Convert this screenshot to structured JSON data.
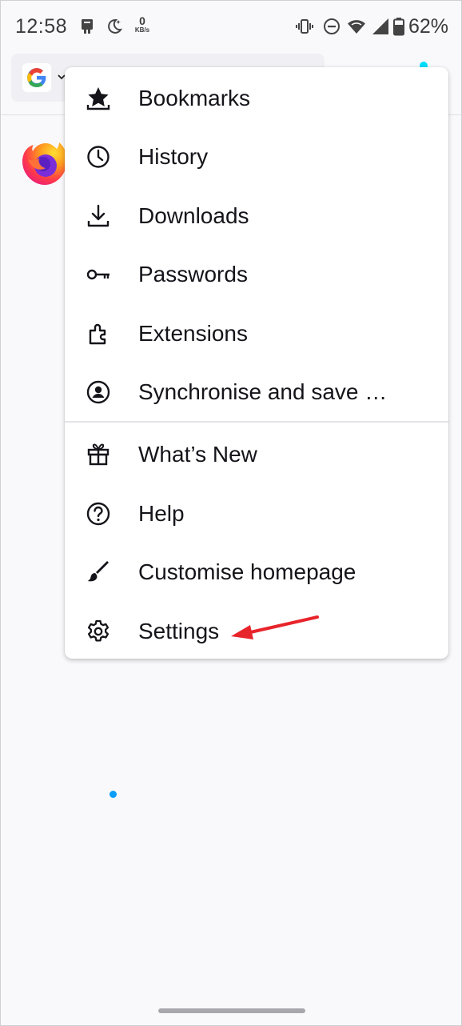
{
  "status_bar": {
    "time": "12:58",
    "net_speed_value": "0",
    "net_speed_unit": "KB/s",
    "battery": "62%"
  },
  "toolbar": {
    "search_engine_icon": "google-g-icon",
    "attention_dot_color": "#00ddff"
  },
  "menu": {
    "items": [
      {
        "label": "Bookmarks",
        "icon": "bookmark-star-icon"
      },
      {
        "label": "History",
        "icon": "clock-icon"
      },
      {
        "label": "Downloads",
        "icon": "download-icon"
      },
      {
        "label": "Passwords",
        "icon": "key-icon"
      },
      {
        "label": "Extensions",
        "icon": "puzzle-icon"
      },
      {
        "label": "Synchronise and save …",
        "icon": "account-icon"
      },
      {
        "label": "What’s New",
        "icon": "gift-icon"
      },
      {
        "label": "Help",
        "icon": "help-icon"
      },
      {
        "label": "Customise homepage",
        "icon": "paintbrush-icon"
      },
      {
        "label": "Settings",
        "icon": "gear-icon"
      }
    ]
  },
  "annotation": {
    "arrow_color": "#e8242b",
    "points_to": "Settings"
  },
  "colors": {
    "accent_dot": "#0a9dfa",
    "text": "#15141a",
    "background": "#f9f9fb"
  }
}
